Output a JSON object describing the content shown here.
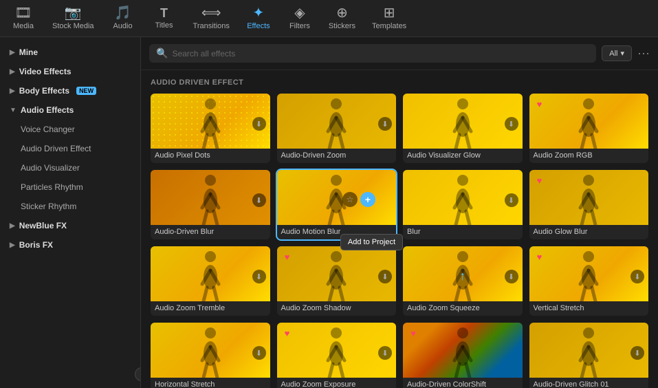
{
  "nav": {
    "items": [
      {
        "id": "media",
        "label": "Media",
        "icon": "🎞",
        "active": false
      },
      {
        "id": "stock-media",
        "label": "Stock Media",
        "icon": "📷",
        "active": false
      },
      {
        "id": "audio",
        "label": "Audio",
        "icon": "🎵",
        "active": false
      },
      {
        "id": "titles",
        "label": "Titles",
        "icon": "T",
        "active": false
      },
      {
        "id": "transitions",
        "label": "Transitions",
        "icon": "⟺",
        "active": false
      },
      {
        "id": "effects",
        "label": "Effects",
        "icon": "✦",
        "active": true
      },
      {
        "id": "filters",
        "label": "Filters",
        "icon": "◈",
        "active": false
      },
      {
        "id": "stickers",
        "label": "Stickers",
        "icon": "⊕",
        "active": false
      },
      {
        "id": "templates",
        "label": "Templates",
        "icon": "⊞",
        "active": false
      }
    ]
  },
  "sidebar": {
    "items": [
      {
        "id": "mine",
        "label": "Mine",
        "type": "section",
        "expanded": false
      },
      {
        "id": "video-effects",
        "label": "Video Effects",
        "type": "section",
        "expanded": false
      },
      {
        "id": "body-effects",
        "label": "Body Effects",
        "type": "section",
        "badge": "NEW",
        "expanded": false
      },
      {
        "id": "audio-effects",
        "label": "Audio Effects",
        "type": "section",
        "expanded": true
      },
      {
        "id": "voice-changer",
        "label": "Voice Changer",
        "type": "sub"
      },
      {
        "id": "audio-driven-effect",
        "label": "Audio Driven Effect",
        "type": "sub",
        "active": true
      },
      {
        "id": "audio-visualizer",
        "label": "Audio Visualizer",
        "type": "sub"
      },
      {
        "id": "particles-rhythm",
        "label": "Particles Rhythm",
        "type": "sub"
      },
      {
        "id": "sticker-rhythm",
        "label": "Sticker Rhythm",
        "type": "sub"
      },
      {
        "id": "newblue-fx",
        "label": "NewBlue FX",
        "type": "section",
        "expanded": false
      },
      {
        "id": "boris-fx",
        "label": "Boris FX",
        "type": "section",
        "expanded": false
      }
    ],
    "collapse_label": "‹"
  },
  "search": {
    "placeholder": "Search all effects",
    "filter_label": "All",
    "more_label": "···"
  },
  "section_title": "AUDIO DRIVEN EFFECT",
  "effects": [
    {
      "id": "audio-pixel-dots",
      "label": "Audio Pixel Dots",
      "thumb": "pixel",
      "has_fav": false,
      "has_download": true
    },
    {
      "id": "audio-driven-zoom",
      "label": "Audio-Driven Zoom",
      "thumb": "yellow-warm",
      "has_fav": false,
      "has_download": true
    },
    {
      "id": "audio-visualizer-glow",
      "label": "Audio Visualizer Glow",
      "thumb": "bright",
      "has_fav": false,
      "has_download": true
    },
    {
      "id": "audio-zoom-rgb",
      "label": "Audio Zoom RGB",
      "thumb": "yellow",
      "has_fav": true,
      "has_download": false
    },
    {
      "id": "audio-driven-blur",
      "label": "Audio-Driven Blur",
      "thumb": "orange",
      "has_fav": false,
      "has_download": true
    },
    {
      "id": "audio-motion-blur",
      "label": "Audio Motion Blur",
      "thumb": "yellow",
      "has_fav": false,
      "has_download": false,
      "highlighted": true,
      "show_popup": true
    },
    {
      "id": "blur",
      "label": "Blur",
      "thumb": "bright",
      "has_fav": false,
      "has_download": true
    },
    {
      "id": "audio-glow-blur",
      "label": "Audio Glow Blur",
      "thumb": "yellow-warm",
      "has_fav": true,
      "has_download": false
    },
    {
      "id": "audio-zoom-tremble",
      "label": "Audio Zoom Tremble",
      "thumb": "yellow",
      "has_fav": false,
      "has_download": true
    },
    {
      "id": "audio-zoom-shadow",
      "label": "Audio Zoom Shadow",
      "thumb": "yellow-warm",
      "has_fav": true,
      "has_download": true
    },
    {
      "id": "audio-zoom-squeeze",
      "label": "Audio Zoom Squeeze",
      "thumb": "yellow",
      "has_fav": false,
      "has_download": true,
      "show_arrow": true
    },
    {
      "id": "vertical-stretch",
      "label": "Vertical Stretch",
      "thumb": "yellow",
      "has_fav": true,
      "has_download": true
    },
    {
      "id": "horizontal-stretch",
      "label": "Horizontal Stretch",
      "thumb": "yellow",
      "has_fav": false,
      "has_download": true
    },
    {
      "id": "audio-zoom-exposure",
      "label": "Audio Zoom Exposure",
      "thumb": "bright",
      "has_fav": true,
      "has_download": true
    },
    {
      "id": "audio-driven-colorshift",
      "label": "Audio-Driven ColorShift",
      "thumb": "colorful",
      "has_fav": true,
      "has_download": false
    },
    {
      "id": "audio-driven-glitch-01",
      "label": "Audio-Driven Glitch 01",
      "thumb": "yellow-warm",
      "has_fav": false,
      "has_download": true
    }
  ],
  "popup": {
    "label": "Add to Project"
  }
}
